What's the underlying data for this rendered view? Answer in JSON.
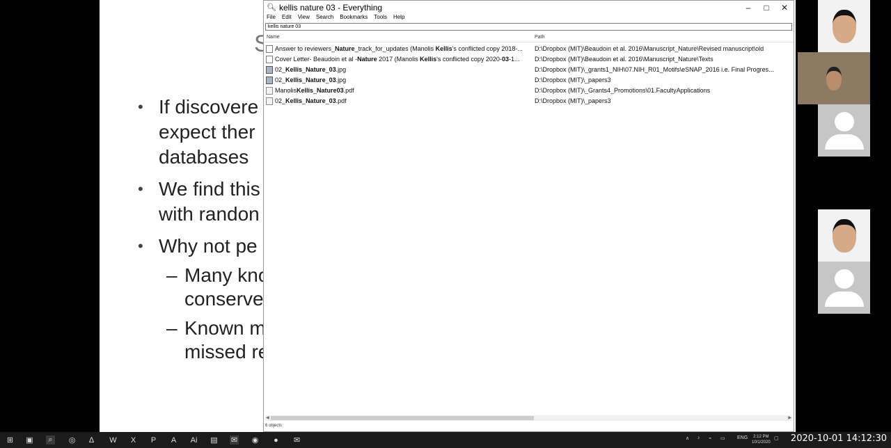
{
  "window": {
    "title": "kellis nature 03 - Everything",
    "menu": [
      "File",
      "Edit",
      "View",
      "Search",
      "Bookmarks",
      "Tools",
      "Help"
    ],
    "search_value": "kellis nature 03",
    "columns": {
      "name": "Name",
      "path": "Path"
    },
    "status": "6 objects",
    "results": [
      {
        "name_parts": [
          {
            "t": "Answer to reviewers_",
            "b": false
          },
          {
            "t": "Nature",
            "b": true
          },
          {
            "t": "_track_for_updates (Manolis ",
            "b": false
          },
          {
            "t": "Kellis",
            "b": true
          },
          {
            "t": "'s conflicted copy 2018-...",
            "b": false
          }
        ],
        "path": "D:\\Dropbox (MIT)\\Beaudoin et al. 2016\\Manuscript_Nature\\Revised manuscript\\old",
        "icon": "doc"
      },
      {
        "name_parts": [
          {
            "t": "Cover Letter- Beaudoin et al -",
            "b": false
          },
          {
            "t": "Nature",
            "b": true
          },
          {
            "t": " 2017 (Manolis ",
            "b": false
          },
          {
            "t": "Kellis",
            "b": true
          },
          {
            "t": "'s conflicted copy 2020-",
            "b": false
          },
          {
            "t": "03",
            "b": true
          },
          {
            "t": "-1...",
            "b": false
          }
        ],
        "path": "D:\\Dropbox (MIT)\\Beaudoin et al. 2016\\Manuscript_Nature\\Texts",
        "icon": "doc"
      },
      {
        "name_parts": [
          {
            "t": "02_",
            "b": false
          },
          {
            "t": "Kellis",
            "b": true
          },
          {
            "t": "_",
            "b": false
          },
          {
            "t": "Nature",
            "b": true
          },
          {
            "t": "_",
            "b": false
          },
          {
            "t": "03",
            "b": true
          },
          {
            "t": ".jpg",
            "b": false
          }
        ],
        "path": "D:\\Dropbox (MIT)\\_grants1_NIH\\07.NIH_R01_Motifs\\eSNAP_2016 i.e. Final Progres...",
        "icon": "img"
      },
      {
        "name_parts": [
          {
            "t": "02_",
            "b": false
          },
          {
            "t": "Kellis",
            "b": true
          },
          {
            "t": "_",
            "b": false
          },
          {
            "t": "Nature",
            "b": true
          },
          {
            "t": "_",
            "b": false
          },
          {
            "t": "03",
            "b": true
          },
          {
            "t": ".jpg",
            "b": false
          }
        ],
        "path": "D:\\Dropbox (MIT)\\_papers3",
        "icon": "img"
      },
      {
        "name_parts": [
          {
            "t": "Manolis",
            "b": false
          },
          {
            "t": "Kellis",
            "b": true
          },
          {
            "t": "_",
            "b": false
          },
          {
            "t": "Nature",
            "b": true
          },
          {
            "t": "03",
            "b": true
          },
          {
            "t": ".pdf",
            "b": false
          }
        ],
        "path": "D:\\Dropbox (MIT)\\_Grants4_Promotions\\01.FacultyApplications",
        "icon": "pdf"
      },
      {
        "name_parts": [
          {
            "t": "02_",
            "b": false
          },
          {
            "t": "Kellis",
            "b": true
          },
          {
            "t": "_",
            "b": false
          },
          {
            "t": "Nature",
            "b": true
          },
          {
            "t": "_",
            "b": false
          },
          {
            "t": "03",
            "b": true
          },
          {
            "t": ".pdf",
            "b": false
          }
        ],
        "path": "D:\\Dropbox (MIT)\\_papers3",
        "icon": "pdf"
      }
    ]
  },
  "slide": {
    "title": "S",
    "lines": [
      {
        "kind": "bullet",
        "text": "If discovere"
      },
      {
        "kind": "cont",
        "text": "expect ther"
      },
      {
        "kind": "cont",
        "text": "databases"
      },
      {
        "kind": "bullet",
        "text": "We find this"
      },
      {
        "kind": "cont",
        "text": "with randon"
      },
      {
        "kind": "bullet",
        "text": "Why not pe"
      },
      {
        "kind": "dash",
        "text": "Many kno"
      },
      {
        "kind": "cont2",
        "text": "conserve"
      },
      {
        "kind": "dash",
        "text": "Known m"
      },
      {
        "kind": "cont2",
        "text": "missed re"
      }
    ]
  },
  "taskbar": {
    "lang": "ENG",
    "time": "2:12 PM",
    "date": "10/1/2020",
    "overlay_timestamp": "2020-10-01  14:12:30"
  },
  "colors": {
    "window_bg": "#ffffff",
    "taskbar_bg": "#1b1b1b",
    "slide_bg": "#ffffff"
  }
}
